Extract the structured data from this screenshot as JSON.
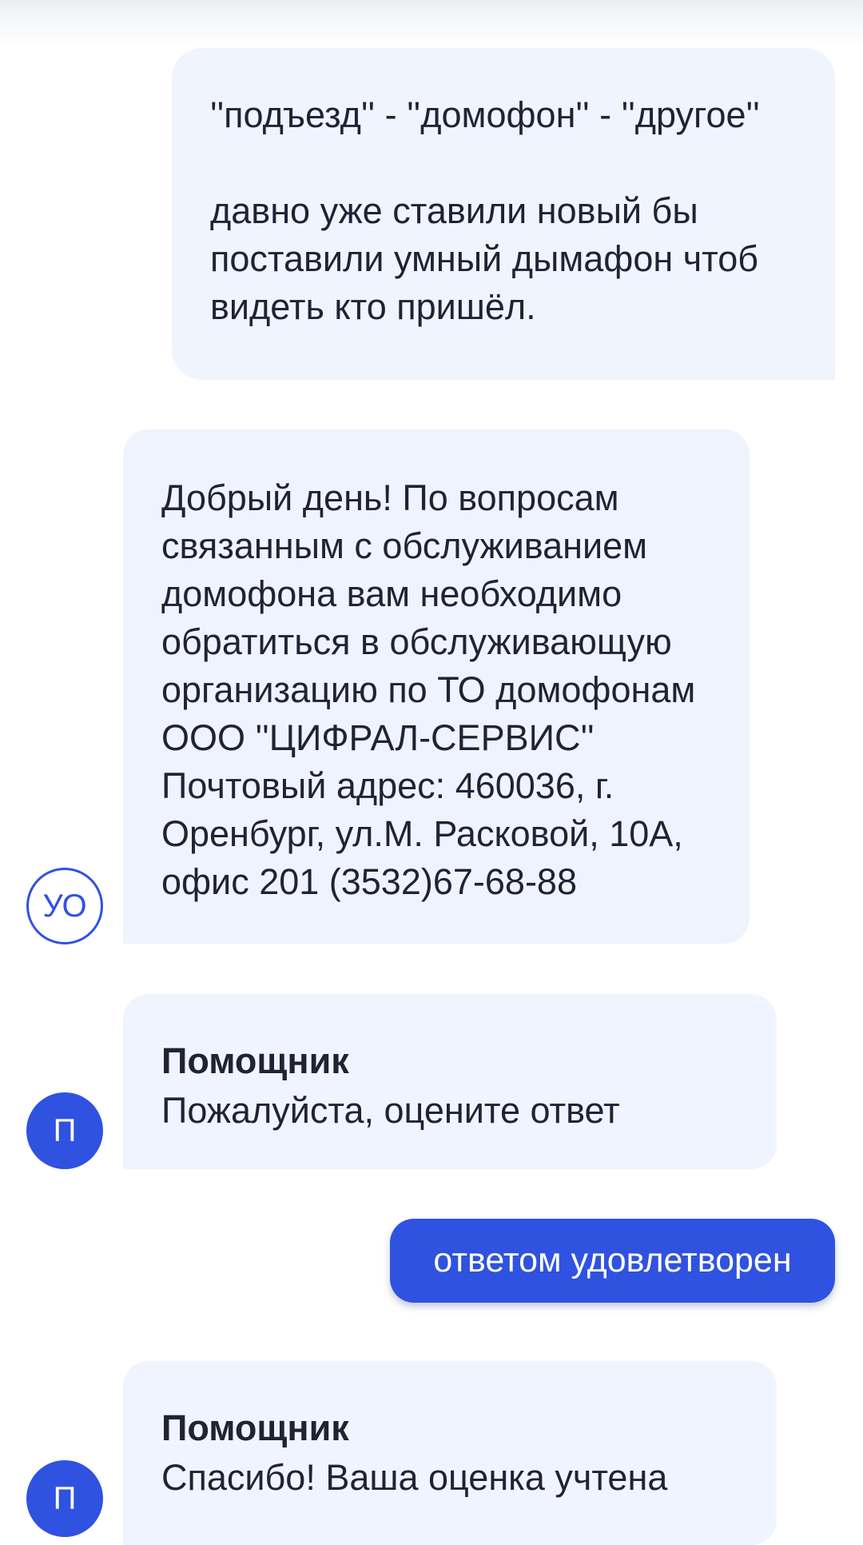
{
  "messages": {
    "user_1": {
      "line_1": "''подъезд'' - ''домофон'' - ''другое''",
      "line_2": "давно уже ставили новый бы",
      "line_3": "поставили умный дымафон чтоб",
      "line_4": "видеть кто пришёл."
    },
    "operator": {
      "avatar": "УО",
      "lines": [
        "Добрый день! По вопросам",
        "связанным с обслуживанием",
        "домофона вам необходимо",
        "обратиться в обслуживающую",
        "организацию по ТО домофонам",
        "ООО ''ЦИФРАЛ-СЕРВИС''",
        "Почтовый адрес: 460036, г.",
        "Оренбург, ул.М. Расковой, 10А,",
        "офис 201 (3532)67-68-88"
      ]
    },
    "bot_1": {
      "avatar": "П",
      "sender": "Помощник",
      "text": "Пожалуйста, оцените ответ"
    },
    "user_reply": {
      "text": "ответом удовлетворен"
    },
    "bot_2": {
      "avatar": "П",
      "sender": "Помощник",
      "text": "Спасибо! Ваша оценка учтена"
    }
  },
  "colors": {
    "accent": "#2f52e0",
    "bubble_user": "#eff4fd",
    "bubble_bot": "#f0f4fe",
    "text": "#1f2333"
  }
}
